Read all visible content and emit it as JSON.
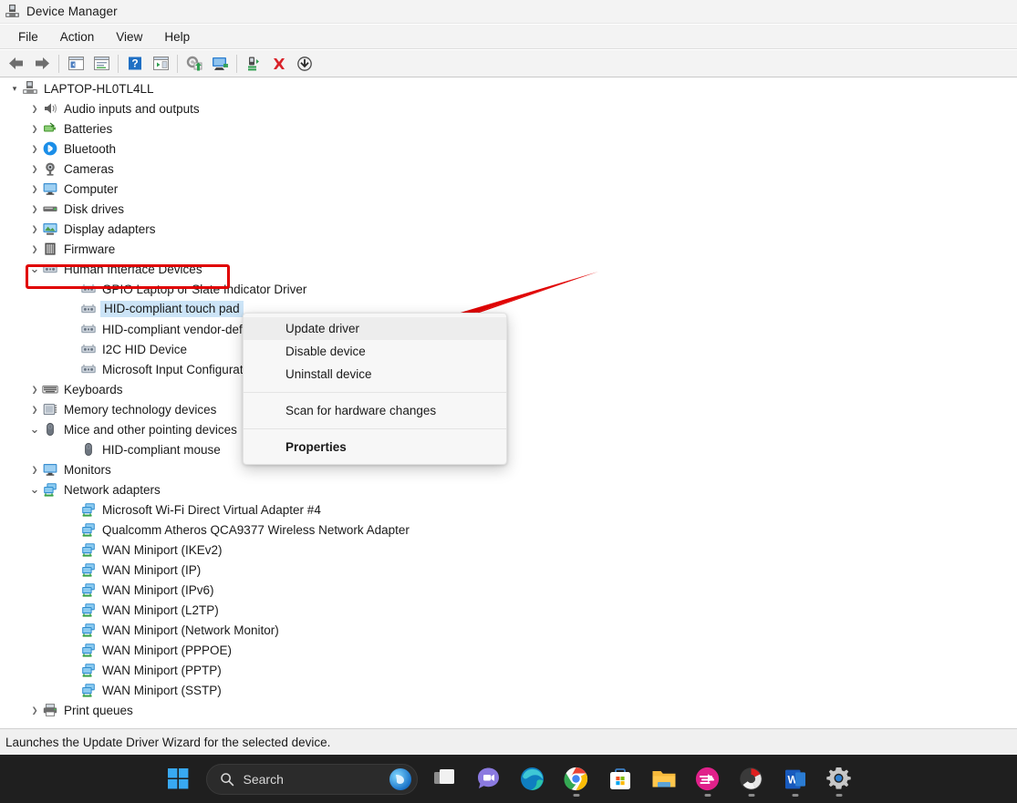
{
  "window": {
    "title": "Device Manager",
    "icon": "device-manager-icon"
  },
  "menubar": {
    "items": [
      {
        "label": "File"
      },
      {
        "label": "Action"
      },
      {
        "label": "View"
      },
      {
        "label": "Help"
      }
    ]
  },
  "toolbar": {
    "buttons": [
      {
        "name": "back-arrow-icon",
        "tooltip": "Back"
      },
      {
        "name": "forward-arrow-icon",
        "tooltip": "Forward"
      },
      {
        "name": "show-hide-console-tree-icon",
        "tooltip": "Show/Hide Console Tree"
      },
      {
        "name": "properties-icon",
        "tooltip": "Properties"
      },
      {
        "name": "help-icon",
        "tooltip": "Help"
      },
      {
        "name": "show-hide-action-pane-icon",
        "tooltip": "Show/Hide Action Pane"
      },
      {
        "name": "update-driver-icon",
        "tooltip": "Update driver"
      },
      {
        "name": "scan-for-hardware-changes-icon",
        "tooltip": "Scan for hardware changes"
      },
      {
        "name": "enable-device-icon",
        "tooltip": "Enable device"
      },
      {
        "name": "uninstall-device-icon",
        "tooltip": "Uninstall device"
      },
      {
        "name": "disable-device-icon",
        "tooltip": "Disable device"
      }
    ]
  },
  "tree": {
    "root": {
      "label": "LAPTOP-HL0TL4LL",
      "icon": "computer-root-icon",
      "expanded": true
    },
    "nodes": [
      {
        "label": "Audio inputs and outputs",
        "icon": "speaker-icon",
        "level": 1,
        "state": "collapsed"
      },
      {
        "label": "Batteries",
        "icon": "battery-icon",
        "level": 1,
        "state": "collapsed"
      },
      {
        "label": "Bluetooth",
        "icon": "bluetooth-icon",
        "level": 1,
        "state": "collapsed"
      },
      {
        "label": "Cameras",
        "icon": "camera-icon",
        "level": 1,
        "state": "collapsed"
      },
      {
        "label": "Computer",
        "icon": "monitor-icon",
        "level": 1,
        "state": "collapsed"
      },
      {
        "label": "Disk drives",
        "icon": "disk-icon",
        "level": 1,
        "state": "collapsed"
      },
      {
        "label": "Display adapters",
        "icon": "display-adapter-icon",
        "level": 1,
        "state": "collapsed"
      },
      {
        "label": "Firmware",
        "icon": "firmware-icon",
        "level": 1,
        "state": "collapsed"
      },
      {
        "label": "Human Interface Devices",
        "icon": "hid-icon",
        "level": 1,
        "state": "expanded",
        "highlighted_box": true
      },
      {
        "label": "GPIO Laptop or Slate Indicator Driver",
        "icon": "hid-icon",
        "level": 2,
        "state": "leaf"
      },
      {
        "label": "HID-compliant touch pad",
        "icon": "hid-icon",
        "level": 2,
        "state": "leaf",
        "selected": true
      },
      {
        "label": "HID-compliant vendor-defined device",
        "icon": "hid-icon",
        "level": 2,
        "state": "leaf"
      },
      {
        "label": "I2C HID Device",
        "icon": "hid-icon",
        "level": 2,
        "state": "leaf"
      },
      {
        "label": "Microsoft Input Configuration Device",
        "icon": "hid-icon",
        "level": 2,
        "state": "leaf"
      },
      {
        "label": "Keyboards",
        "icon": "keyboard-icon",
        "level": 1,
        "state": "collapsed"
      },
      {
        "label": "Memory technology devices",
        "icon": "memory-icon",
        "level": 1,
        "state": "collapsed"
      },
      {
        "label": "Mice and other pointing devices",
        "icon": "mouse-icon",
        "level": 1,
        "state": "expanded"
      },
      {
        "label": "HID-compliant mouse",
        "icon": "mouse-icon",
        "level": 2,
        "state": "leaf"
      },
      {
        "label": "Monitors",
        "icon": "monitor-icon",
        "level": 1,
        "state": "collapsed"
      },
      {
        "label": "Network adapters",
        "icon": "network-icon",
        "level": 1,
        "state": "expanded"
      },
      {
        "label": "Microsoft Wi-Fi Direct Virtual Adapter #4",
        "icon": "network-icon",
        "level": 2,
        "state": "leaf"
      },
      {
        "label": "Qualcomm Atheros QCA9377 Wireless Network Adapter",
        "icon": "network-icon",
        "level": 2,
        "state": "leaf"
      },
      {
        "label": "WAN Miniport (IKEv2)",
        "icon": "network-icon",
        "level": 2,
        "state": "leaf"
      },
      {
        "label": "WAN Miniport (IP)",
        "icon": "network-icon",
        "level": 2,
        "state": "leaf"
      },
      {
        "label": "WAN Miniport (IPv6)",
        "icon": "network-icon",
        "level": 2,
        "state": "leaf"
      },
      {
        "label": "WAN Miniport (L2TP)",
        "icon": "network-icon",
        "level": 2,
        "state": "leaf"
      },
      {
        "label": "WAN Miniport (Network Monitor)",
        "icon": "network-icon",
        "level": 2,
        "state": "leaf"
      },
      {
        "label": "WAN Miniport (PPPOE)",
        "icon": "network-icon",
        "level": 2,
        "state": "leaf"
      },
      {
        "label": "WAN Miniport (PPTP)",
        "icon": "network-icon",
        "level": 2,
        "state": "leaf"
      },
      {
        "label": "WAN Miniport (SSTP)",
        "icon": "network-icon",
        "level": 2,
        "state": "leaf"
      },
      {
        "label": "Print queues",
        "icon": "printer-icon",
        "level": 1,
        "state": "collapsed"
      }
    ]
  },
  "context_menu": {
    "items": [
      {
        "label": "Update driver",
        "highlighted": true,
        "bold": false
      },
      {
        "label": "Disable device",
        "highlighted": false,
        "bold": false
      },
      {
        "label": "Uninstall device",
        "highlighted": false,
        "bold": false
      },
      {
        "separator": true
      },
      {
        "label": "Scan for hardware changes",
        "highlighted": false,
        "bold": false
      },
      {
        "separator": true
      },
      {
        "label": "Properties",
        "highlighted": false,
        "bold": true
      }
    ]
  },
  "status_bar": {
    "text": "Launches the Update Driver Wizard for the selected device."
  },
  "taskbar": {
    "start": {
      "name": "start-button"
    },
    "search": {
      "placeholder": "Search",
      "icon": "search-icon",
      "copilot": "copilot-icon"
    },
    "items": [
      {
        "name": "task-view-icon",
        "running": false
      },
      {
        "name": "chat-teams-icon",
        "running": false
      },
      {
        "name": "microsoft-edge-icon",
        "running": false
      },
      {
        "name": "google-chrome-icon",
        "running": true
      },
      {
        "name": "microsoft-store-icon",
        "running": false
      },
      {
        "name": "file-explorer-icon",
        "running": false
      },
      {
        "name": "pink-app-icon",
        "running": true
      },
      {
        "name": "red-circle-app-icon",
        "running": true
      },
      {
        "name": "microsoft-word-icon",
        "running": true
      },
      {
        "name": "settings-gear-icon",
        "running": true
      }
    ]
  },
  "annotations": {
    "red_box_target": "Human Interface Devices",
    "red_arrow_target": "Update driver",
    "accent_color": "#e00000",
    "selection_color": "#cce4f7"
  }
}
